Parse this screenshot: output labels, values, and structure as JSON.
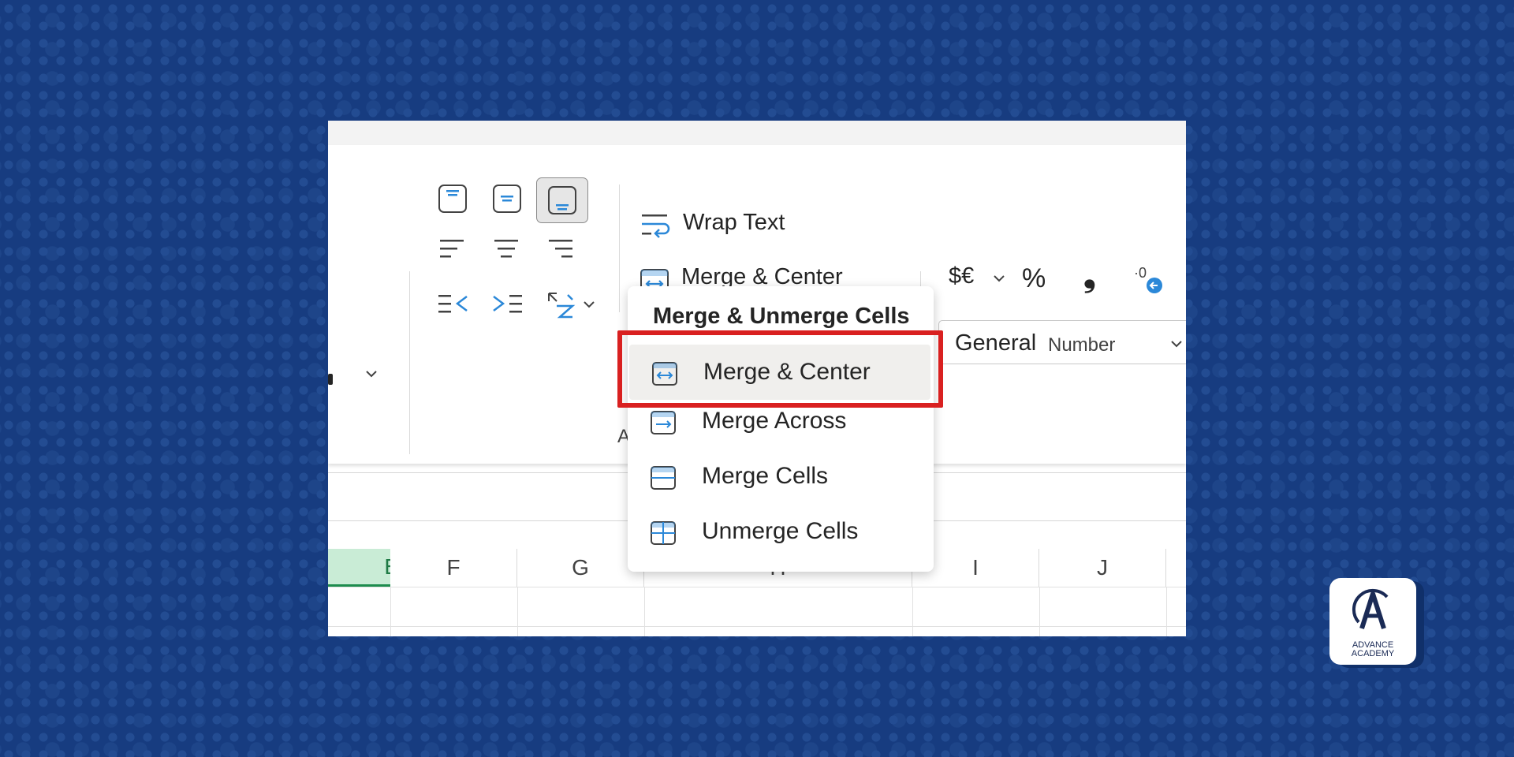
{
  "ribbon": {
    "wrap_text_label": "Wrap Text",
    "merge_center_label": "Merge & Center",
    "number_format_value": "General",
    "number_group_label": "Number",
    "alignment_group_label_partial": "A",
    "currency_label": "$€",
    "percent_label": "%",
    "comma_label": "❟"
  },
  "dropdown": {
    "title": "Merge & Unmerge Cells",
    "items": [
      {
        "label": "Merge & Center",
        "icon": "merge-center-icon",
        "selected": true
      },
      {
        "label": "Merge Across",
        "icon": "merge-across-icon",
        "selected": false
      },
      {
        "label": "Merge Cells",
        "icon": "merge-cells-icon",
        "selected": false
      },
      {
        "label": "Unmerge Cells",
        "icon": "unmerge-cells-icon",
        "selected": false
      }
    ]
  },
  "grid": {
    "columns": [
      "E",
      "F",
      "G",
      "H",
      "I",
      "J"
    ],
    "active_column": "E"
  },
  "logo": {
    "line1": "ADVANCE",
    "line2": "ACADEMY"
  },
  "colors": {
    "background": "#173c80",
    "accent": "#1e8c4e",
    "highlight": "#d92020",
    "icon_blue": "#2b88d8"
  }
}
